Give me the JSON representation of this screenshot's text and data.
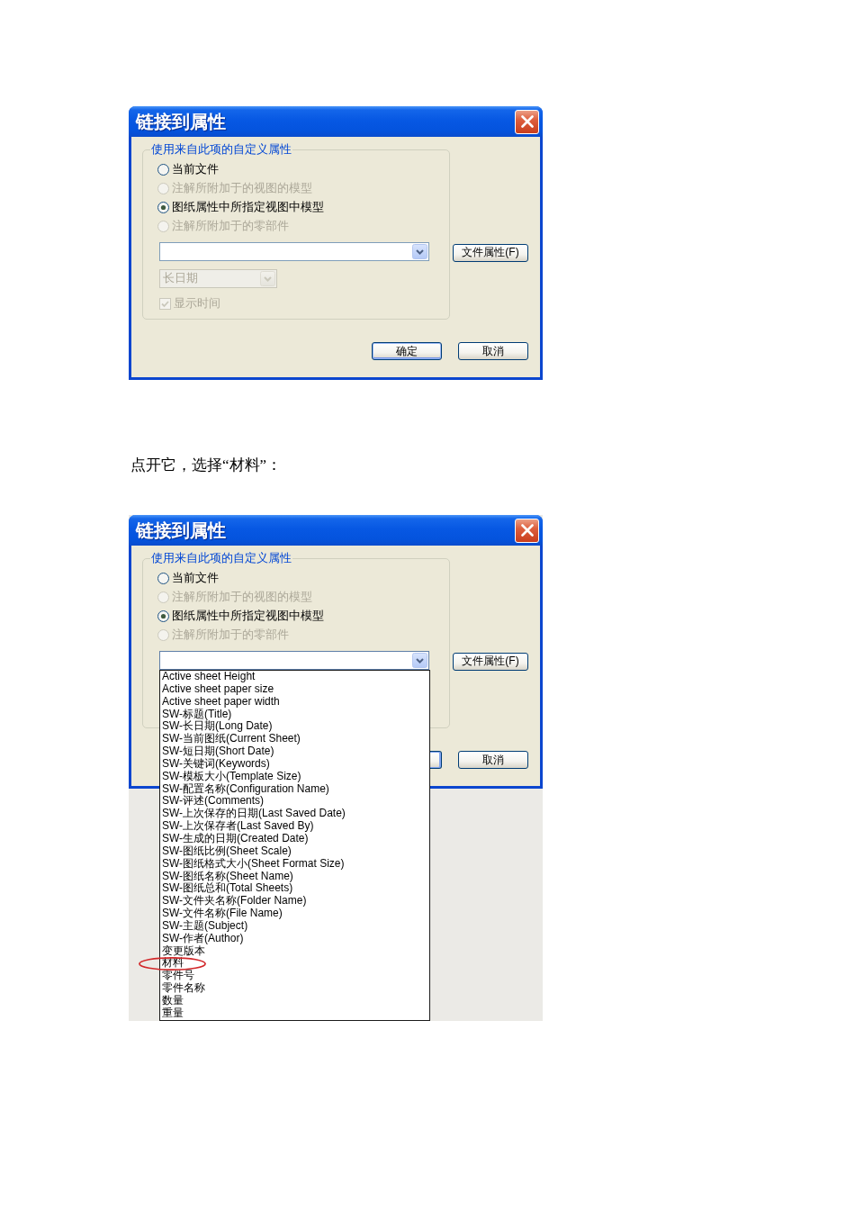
{
  "dialog_1": {
    "title": "链接到属性",
    "group_label": "使用来自此项的自定义属性",
    "radios": [
      {
        "label": "当前文件",
        "selected": false,
        "disabled": false
      },
      {
        "label": "注解所附加于的视图的模型",
        "selected": false,
        "disabled": true
      },
      {
        "label": "图纸属性中所指定视图中模型",
        "selected": true,
        "disabled": false
      },
      {
        "label": "注解所附加于的零部件",
        "selected": false,
        "disabled": true
      }
    ],
    "property_combo": {
      "expanded": false
    },
    "file_properties_button": "文件属性(F)",
    "date_combo": {
      "value": "长日期",
      "disabled": true
    },
    "show_time": {
      "label": "显示时间",
      "checked": true,
      "disabled": true
    },
    "buttons": [
      {
        "label": "确定",
        "default": true,
        "covered": false
      },
      {
        "label": "取消",
        "default": false,
        "covered": false
      }
    ]
  },
  "paragraph": "点开它，选择“材料”：",
  "dialog_2": {
    "title": "链接到属性",
    "group_label": "使用来自此项的自定义属性",
    "radios": [
      {
        "label": "当前文件",
        "selected": false,
        "disabled": false
      },
      {
        "label": "注解所附加于的视图的模型",
        "selected": false,
        "disabled": true
      },
      {
        "label": "图纸属性中所指定视图中模型",
        "selected": true,
        "disabled": false
      },
      {
        "label": "注解所附加于的零部件",
        "selected": false,
        "disabled": true
      }
    ],
    "property_combo": {
      "expanded": true,
      "options": [
        {
          "label": "Active sheet Height",
          "circled": false
        },
        {
          "label": "Active sheet paper size",
          "circled": false
        },
        {
          "label": "Active sheet paper width",
          "circled": false
        },
        {
          "label": "SW-标题(Title)",
          "circled": false
        },
        {
          "label": "SW-长日期(Long Date)",
          "circled": false
        },
        {
          "label": "SW-当前图纸(Current Sheet)",
          "circled": false
        },
        {
          "label": "SW-短日期(Short Date)",
          "circled": false
        },
        {
          "label": "SW-关键词(Keywords)",
          "circled": false
        },
        {
          "label": "SW-模板大小(Template Size)",
          "circled": false
        },
        {
          "label": "SW-配置名称(Configuration Name)",
          "circled": false
        },
        {
          "label": "SW-评述(Comments)",
          "circled": false
        },
        {
          "label": "SW-上次保存的日期(Last Saved Date)",
          "circled": false
        },
        {
          "label": "SW-上次保存者(Last Saved By)",
          "circled": false
        },
        {
          "label": "SW-生成的日期(Created Date)",
          "circled": false
        },
        {
          "label": "SW-图纸比例(Sheet Scale)",
          "circled": false
        },
        {
          "label": "SW-图纸格式大小(Sheet Format Size)",
          "circled": false
        },
        {
          "label": "SW-图纸名称(Sheet Name)",
          "circled": false
        },
        {
          "label": "SW-图纸总和(Total Sheets)",
          "circled": false
        },
        {
          "label": "SW-文件夹名称(Folder Name)",
          "circled": false
        },
        {
          "label": "SW-文件名称(File Name)",
          "circled": false
        },
        {
          "label": "SW-主题(Subject)",
          "circled": false
        },
        {
          "label": "SW-作者(Author)",
          "circled": false
        },
        {
          "label": "变更版本",
          "circled": false
        },
        {
          "label": "材料",
          "circled": true
        },
        {
          "label": "零件号",
          "circled": false
        },
        {
          "label": "零件名称",
          "circled": false
        },
        {
          "label": "数量",
          "circled": false
        },
        {
          "label": "重量",
          "circled": false
        }
      ]
    },
    "file_properties_button": "文件属性(F)",
    "buttons": [
      {
        "default": true,
        "covered": true
      },
      {
        "label": "取消",
        "default": false,
        "covered": false
      }
    ]
  }
}
